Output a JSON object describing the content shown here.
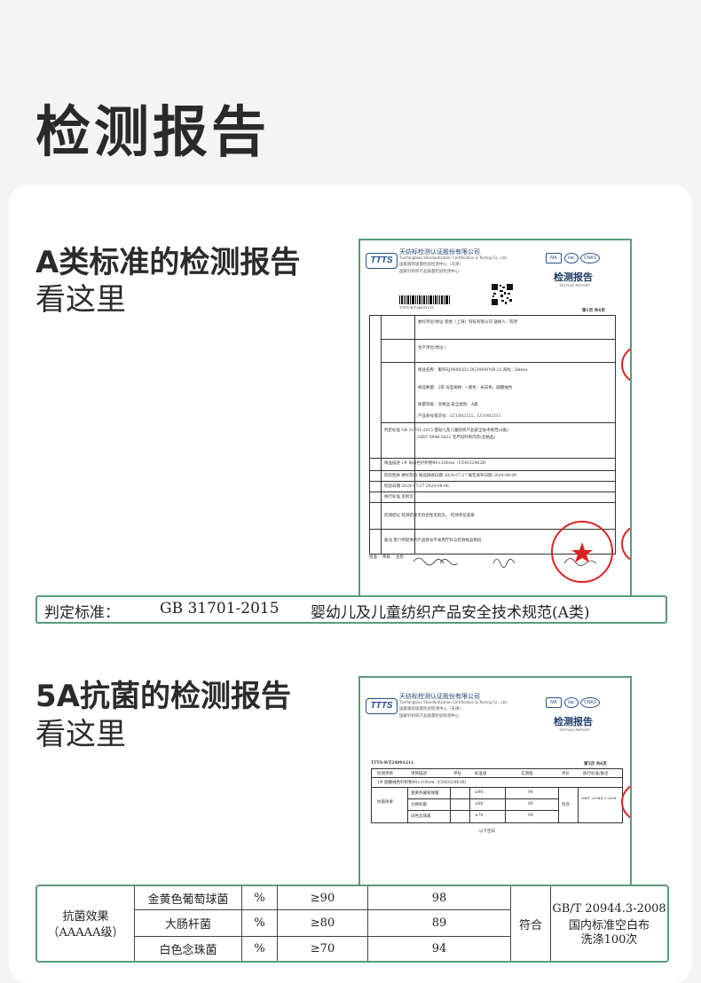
{
  "page": {
    "title": "检测报告"
  },
  "section_a": {
    "heading": "A类标准的检测报告",
    "sub": "看这里"
  },
  "section_b": {
    "heading": "5A抗菌的检测报告",
    "sub": "看这里"
  },
  "report": {
    "logo": "TTTS",
    "org_cn": "天纺标检测认证股份有限公司",
    "org_en": "Tianfangbiao Standardization Certification & Testing Co., Ltd.",
    "center1": "国家服装质量检验检测中心（天津）",
    "center2": "国家针纺织产品质量检验检测中心",
    "title": "检测报告",
    "title_en": "TESTING REPORT",
    "badges": [
      "MA",
      "ilac",
      "CNAS"
    ],
    "code": "TTTS-WT24091211",
    "page_a": "第1页 共6页",
    "page_b": "第5页 共6页"
  },
  "doc_a": {
    "rows": [
      "委托单位/地址  瓷悦（上海）科技有限公司   送样人：陈然",
      "生产单位/地址  /",
      "样品名称：服饰EJ09X6502 DG3069YNB-22  商标：Iikesu",
      "样品数量：2袋   号型规格：/   颜色：米白色、圆圈绒色",
      "质量等级：合格品   安全类别：A类",
      "产品款号或货号：LC1082121，LC1082111",
      "判定标准  GB 31701-2015  婴幼儿及儿童纺织产品安全技术规范(A类)",
      "GB/T 8946-2022  无尺码针织内衣(合格品)",
      "样品描述  1# 米白色针织物90×100cm（FZ4032962B）",
      "检验性质  委托检验  样品接收日期 2024-07-27  报告发布日期 2024-08-09",
      "检验日期  2024-07-27  2024-08-06",
      "执行标准  见附页",
      "检测结论  检测结果见符合性见附页。  检测单位盖章",
      "备注  客户所提供的产品款号不采用厅料与检测样品相同",
      "批准：    审核：    主检："
    ]
  },
  "standard_bar": {
    "label": "判定标准：",
    "code": "GB 31701-2015",
    "name": "婴幼儿及儿童纺织产品安全技术规范(A类)"
  },
  "doc_b": {
    "header": [
      "检测项目",
      "项目描述",
      "单位",
      "标准值",
      "实测值",
      "评价",
      "执行标准/备注"
    ],
    "sample": "1#  圆圈绒色针织物90×100cm（FZ4032962B）",
    "end_note": "以下空白"
  },
  "antibacterial": {
    "item": "抗菌效果",
    "grade": "（AAAAA级）",
    "rows": [
      {
        "bacteria": "金黄色葡萄球菌",
        "unit": "%",
        "standard": "≥90",
        "value": "98"
      },
      {
        "bacteria": "大肠杆菌",
        "unit": "%",
        "standard": "≥80",
        "value": "89"
      },
      {
        "bacteria": "白色念珠菌",
        "unit": "%",
        "standard": "≥70",
        "value": "94"
      }
    ],
    "result": "符合",
    "std_line1": "GB/T 20944.3-2008",
    "std_line2": "国内标准空白布",
    "std_line3": "洗涤100次"
  },
  "colors": {
    "accent": "#5a9a7a",
    "stamp": "#dd2222",
    "brand": "#1f4e8c"
  }
}
